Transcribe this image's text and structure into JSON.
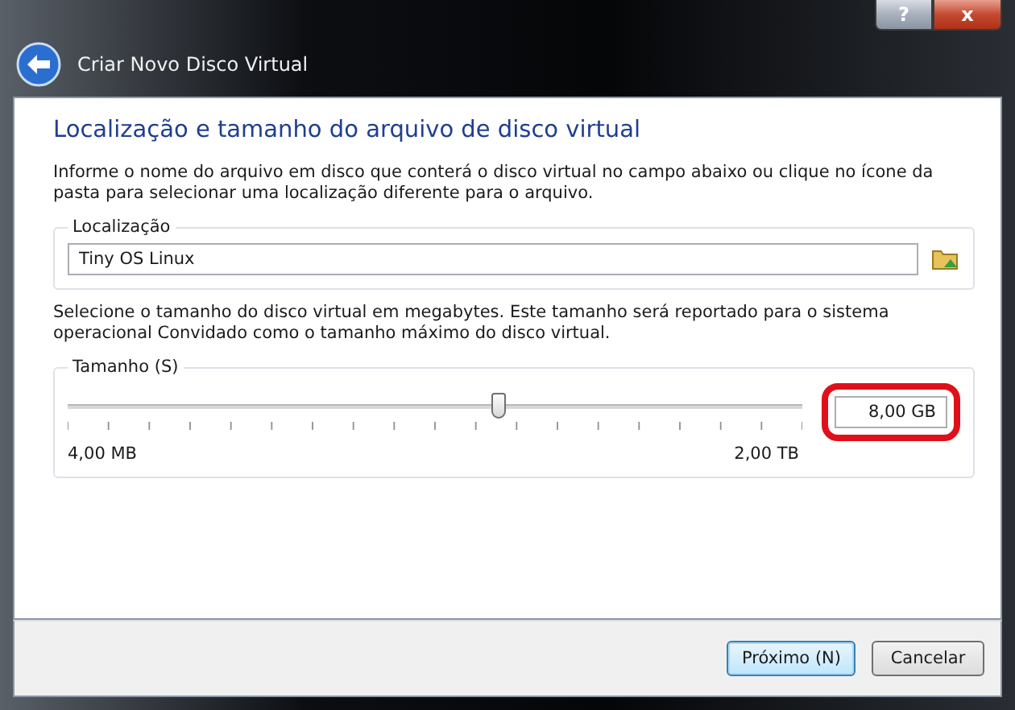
{
  "window": {
    "title": "Criar Novo Disco Virtual",
    "title_buttons": [
      "?",
      "x"
    ]
  },
  "heading": "Localização e tamanho do arquivo de disco virtual",
  "location_intro": "Informe o nome do arquivo em disco que conterá o disco virtual no campo abaixo ou clique no ícone da pasta para selecionar uma localização diferente para o arquivo.",
  "location": {
    "label": "Localização",
    "value": "Tiny OS Linux"
  },
  "size_intro": "Selecione o tamanho do disco virtual em megabytes. Este tamanho será reportado para o sistema operacional Convidado como o tamanho máximo do disco virtual.",
  "size": {
    "label": "Tamanho (S)",
    "level": 0.585,
    "min_label": "4,00 MB",
    "max_label": "2,00 TB",
    "value": "8,00 GB",
    "highlighted": true
  },
  "buttons": [
    {
      "label": "Próximo (N)",
      "default": true
    },
    {
      "label": "Cancelar",
      "default": false
    }
  ]
}
